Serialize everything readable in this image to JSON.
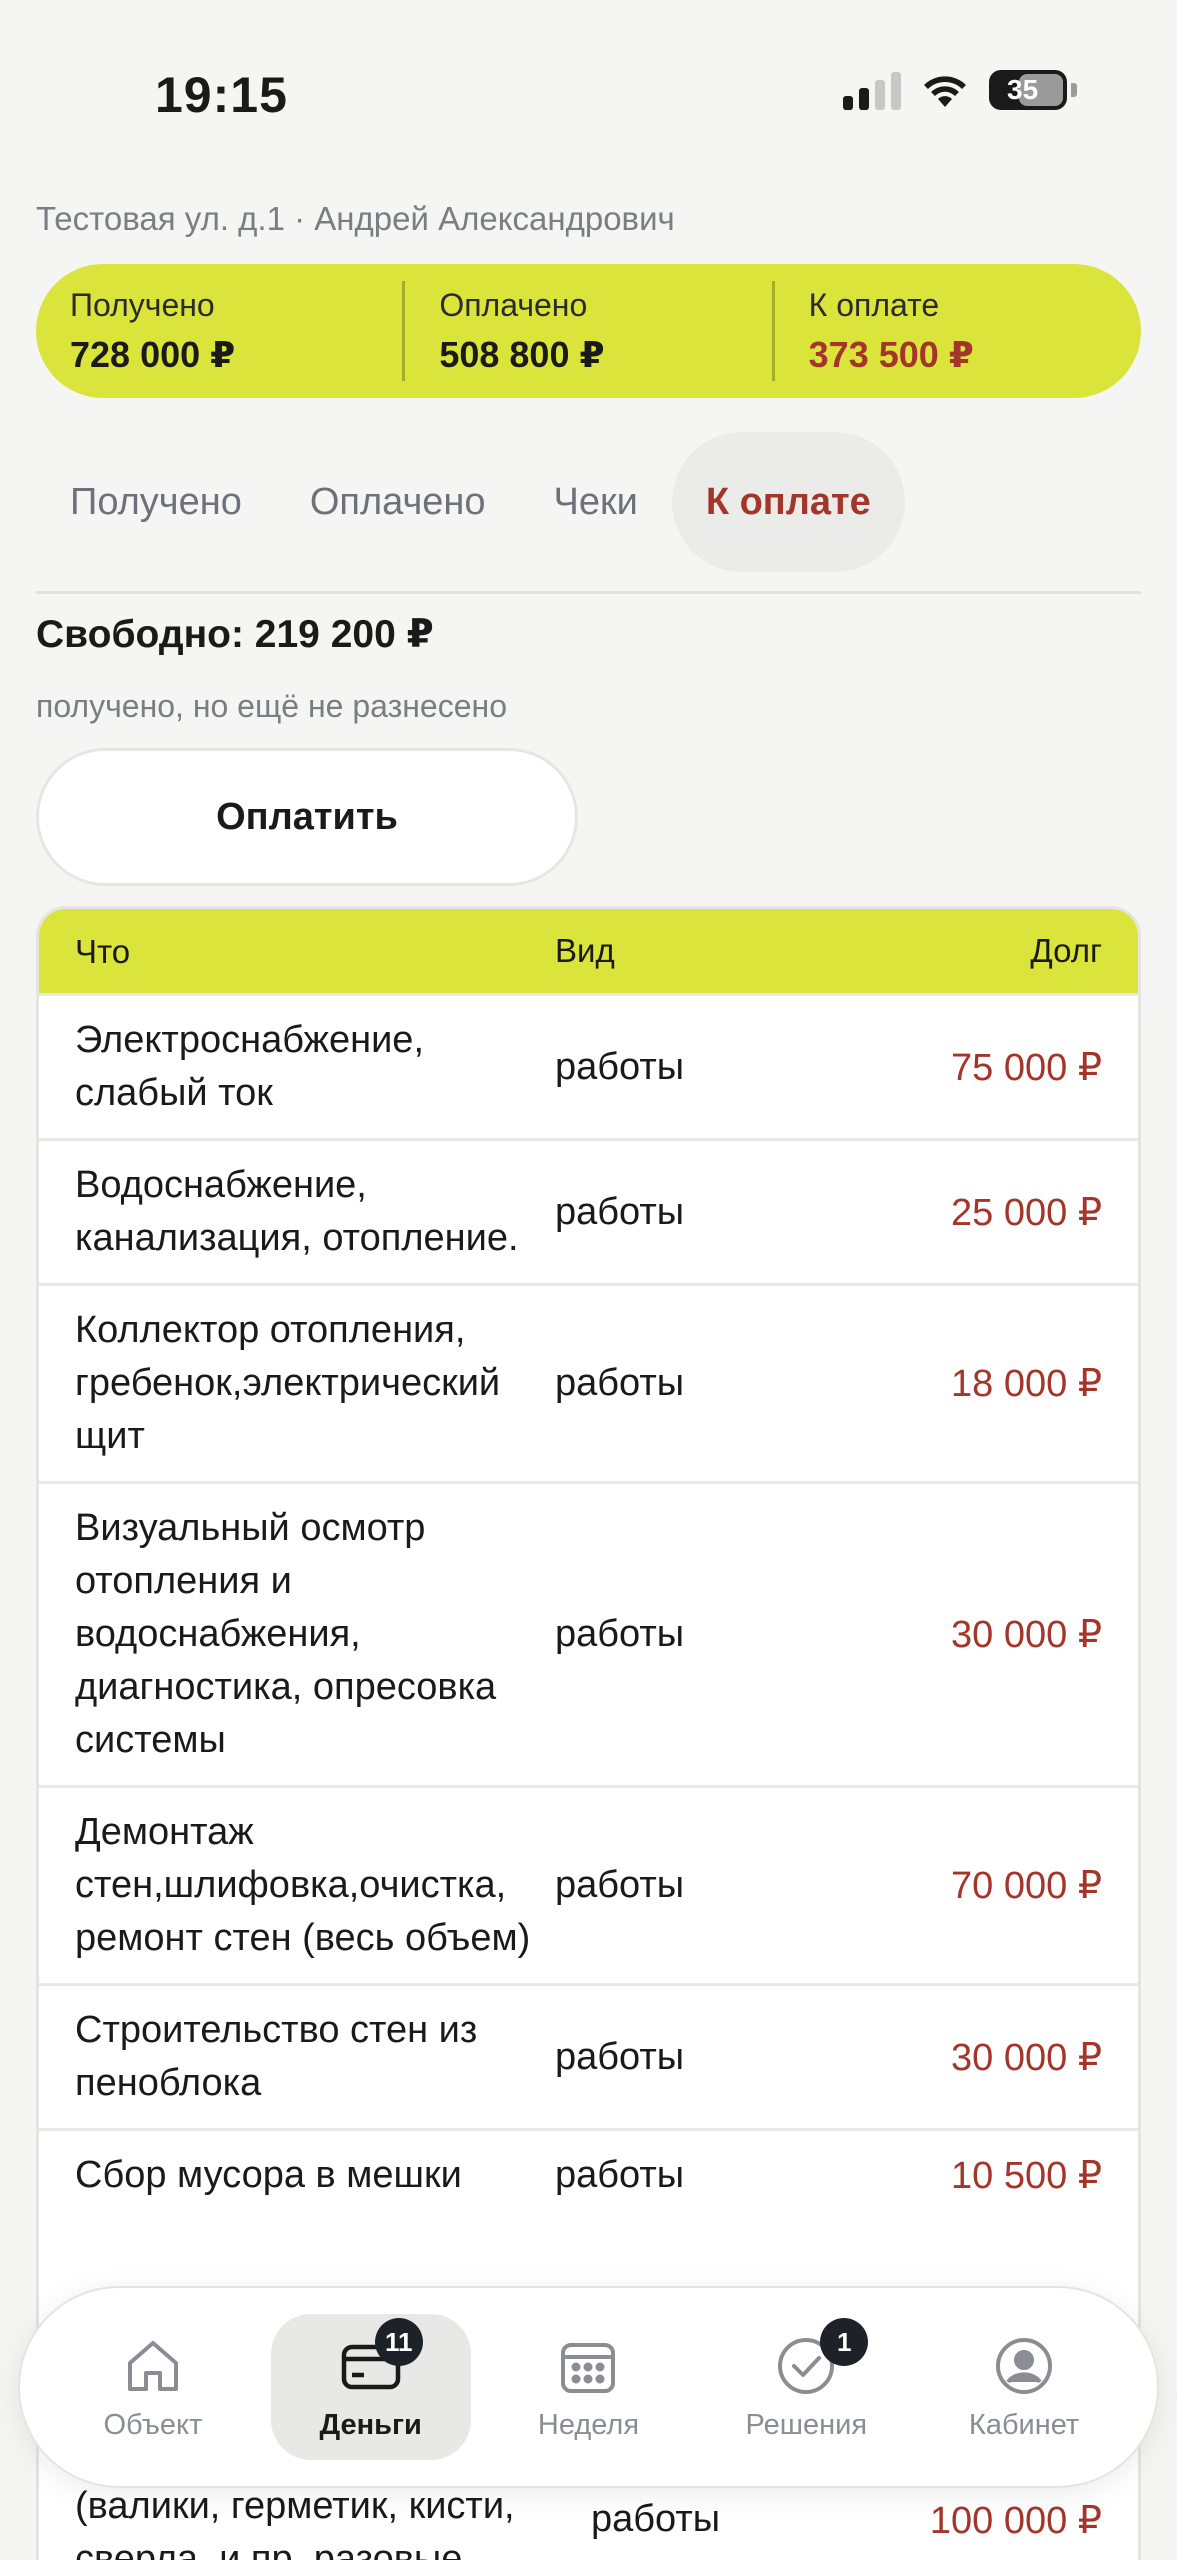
{
  "status": {
    "time": "19:15",
    "battery": "35"
  },
  "header": {
    "subtitle": "Тестовая ул. д.1 · Андрей Александрович"
  },
  "summary": [
    {
      "label": "Получено",
      "value": "728 000 ₽"
    },
    {
      "label": "Оплачено",
      "value": "508 800 ₽"
    },
    {
      "label": "К оплате",
      "value": "373 500 ₽"
    }
  ],
  "tabs": [
    "Получено",
    "Оплачено",
    "Чеки",
    "К оплате"
  ],
  "active_tab": "К оплате",
  "free": {
    "text": "Свободно: 219 200 ₽",
    "note": "получено, но ещё не разнесено"
  },
  "pay_button": "Оплатить",
  "table": {
    "headers": {
      "what": "Что",
      "kind": "Вид",
      "debt": "Долг"
    },
    "rows": [
      {
        "what": "Электроснабжение, слабый ток",
        "kind": "работы",
        "debt": "75 000 ₽"
      },
      {
        "what": "Водоснабжение, канализация, отопление.",
        "kind": "работы",
        "debt": "25 000 ₽"
      },
      {
        "what": "Коллектор отопления, гребенок,электрический щит",
        "kind": "работы",
        "debt": "18 000 ₽"
      },
      {
        "what": "Визуальный осмотр отопления и водоснабжения, диагностика, опресовка системы",
        "kind": "работы",
        "debt": "30 000 ₽"
      },
      {
        "what": "Демонтаж стен,шлифовка,очистка, ремонт стен (весь объем)",
        "kind": "работы",
        "debt": "70 000 ₽"
      },
      {
        "what": "Строительство стен из пеноблока",
        "kind": "работы",
        "debt": "30 000 ₽"
      },
      {
        "what": "Сбор мусора в мешки",
        "kind": "работы",
        "debt": "10 500 ₽"
      }
    ],
    "partial_row": {
      "what": "(валики, герметик, кисти, сверла, и пр. разовые",
      "kind": "работы",
      "debt": "100 000 ₽"
    }
  },
  "nav": [
    {
      "label": "Объект",
      "icon": "house-icon",
      "badge": ""
    },
    {
      "label": "Деньги",
      "icon": "card-icon",
      "badge": "11"
    },
    {
      "label": "Неделя",
      "icon": "calendar-icon",
      "badge": ""
    },
    {
      "label": "Решения",
      "icon": "check-circle-icon",
      "badge": "1"
    },
    {
      "label": "Кабинет",
      "icon": "user-icon",
      "badge": ""
    }
  ]
}
